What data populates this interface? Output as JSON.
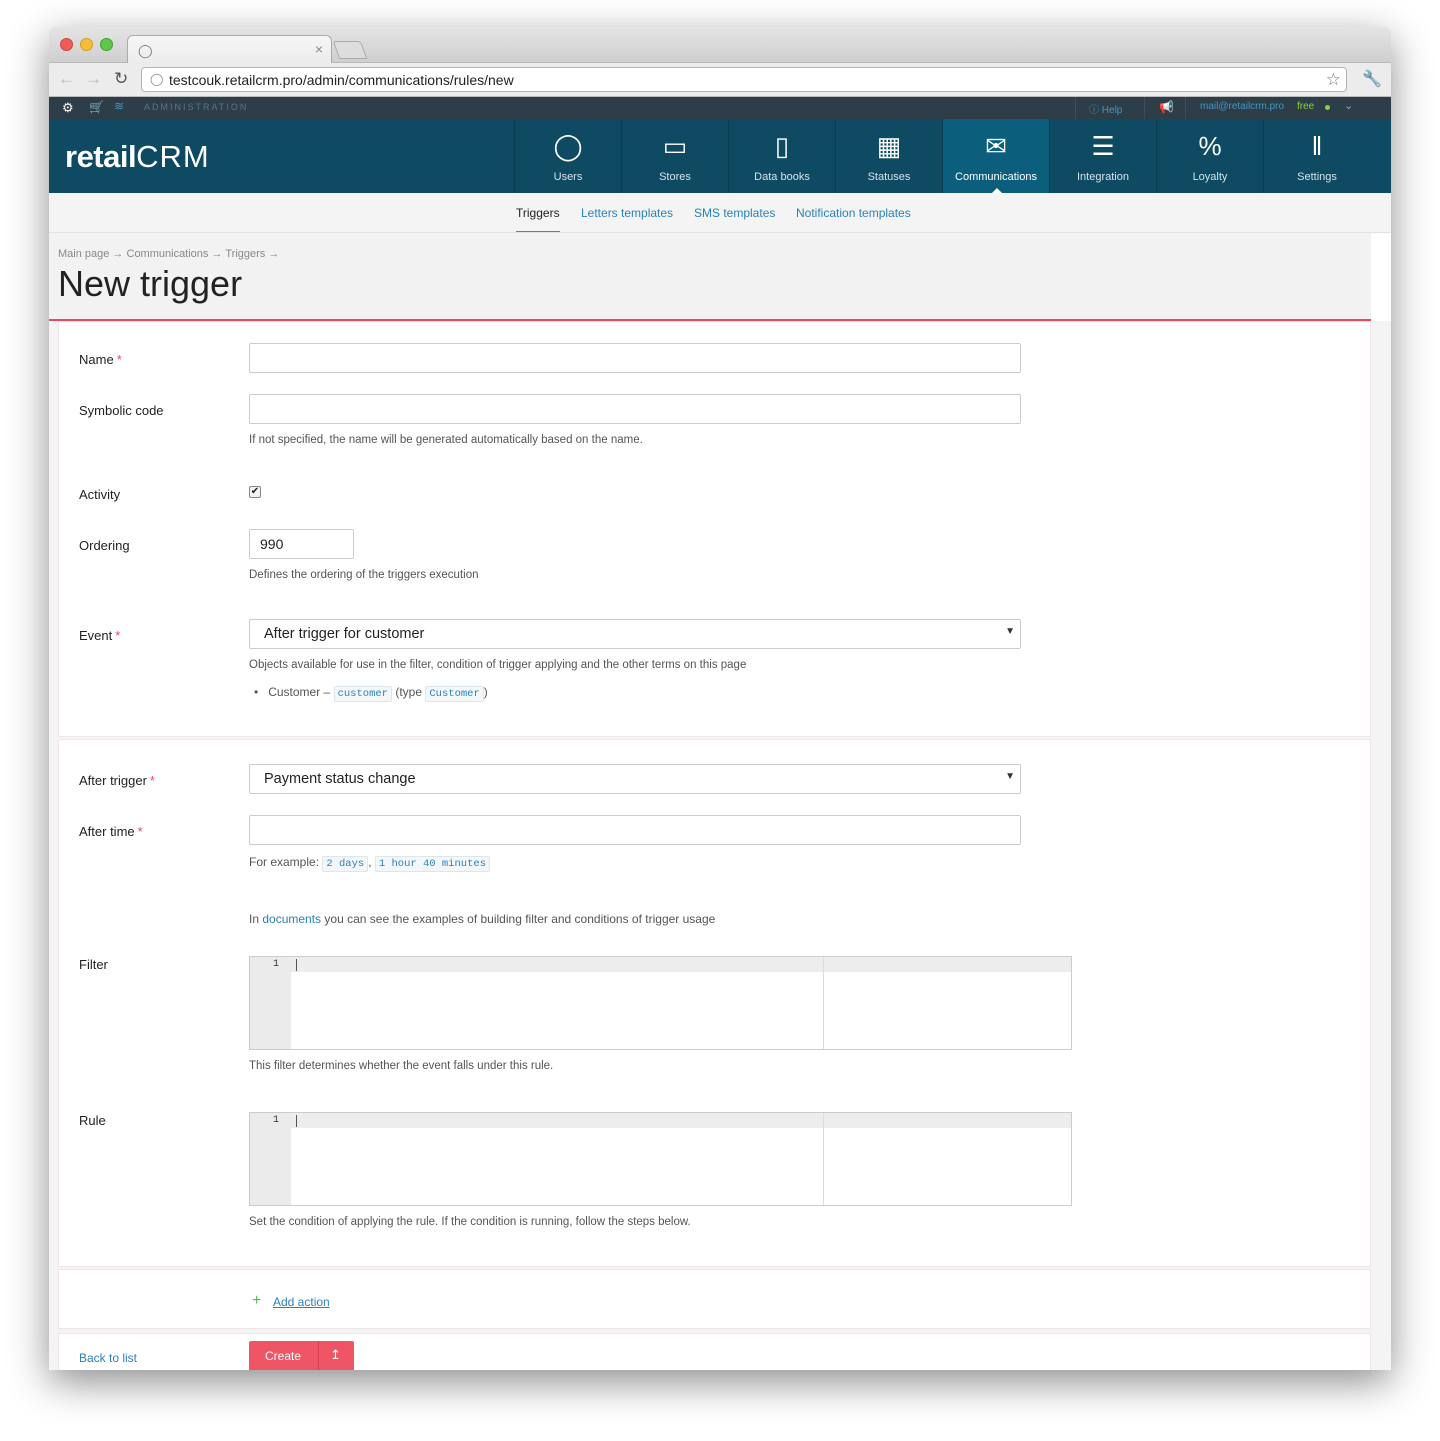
{
  "browser": {
    "url": "testcouk.retailcrm.pro/admin/communications/rules/new"
  },
  "topstrip": {
    "section": "ADMINISTRATION",
    "help": "Help",
    "email": "mail@retailcrm.pro",
    "plan": "free"
  },
  "header": {
    "logo_a": "retail",
    "logo_b": "CRM",
    "nav": [
      {
        "label": "Users",
        "icon": "user-icon"
      },
      {
        "label": "Stores",
        "icon": "store-icon"
      },
      {
        "label": "Data books",
        "icon": "book-icon"
      },
      {
        "label": "Statuses",
        "icon": "grid-icon"
      },
      {
        "label": "Communications",
        "icon": "envelope-icon",
        "active": true
      },
      {
        "label": "Integration",
        "icon": "lines-icon"
      },
      {
        "label": "Loyalty",
        "icon": "percent-tag-icon"
      },
      {
        "label": "Settings",
        "icon": "sliders-icon"
      }
    ]
  },
  "subnav": {
    "tabs": [
      "Triggers",
      "Letters templates",
      "SMS templates",
      "Notification templates"
    ]
  },
  "page": {
    "breadcrumb": [
      "Main page",
      "Communications",
      "Triggers"
    ],
    "title": "New trigger"
  },
  "form": {
    "name_label": "Name",
    "name_value": "",
    "code_label": "Symbolic code",
    "code_value": "",
    "code_hint": "If not specified, the name will be generated automatically based on the name.",
    "activity_label": "Activity",
    "activity_checked": true,
    "ordering_label": "Ordering",
    "ordering_value": "990",
    "ordering_hint": "Defines the ordering of the triggers execution",
    "event_label": "Event",
    "event_value": "After trigger for customer",
    "event_hint": "Objects available for use in the filter, condition of trigger applying and the other terms on this page",
    "object_name": "Customer –",
    "object_var": "customer",
    "object_type_prefix": "(type",
    "object_type": "Customer",
    "object_type_suffix": ")",
    "after_trigger_label": "After trigger",
    "after_trigger_value": "Payment status change",
    "after_time_label": "After time",
    "after_time_value": "",
    "example_prefix": "For example:",
    "example_1": "2 days",
    "example_comma": ",",
    "example_2": "1 hour 40 minutes",
    "docs_prefix": "In",
    "docs_link": "documents",
    "docs_suffix": "you can see the examples of building filter and conditions of trigger usage",
    "filter_label": "Filter",
    "filter_hint": "This filter determines whether the event falls under this rule.",
    "rule_label": "Rule",
    "rule_hint": "Set the condition of applying the rule. If the condition is running, follow the steps below.",
    "line_number": "1",
    "add_action": "Add action",
    "back_link": "Back to list",
    "create_button": "Create"
  }
}
